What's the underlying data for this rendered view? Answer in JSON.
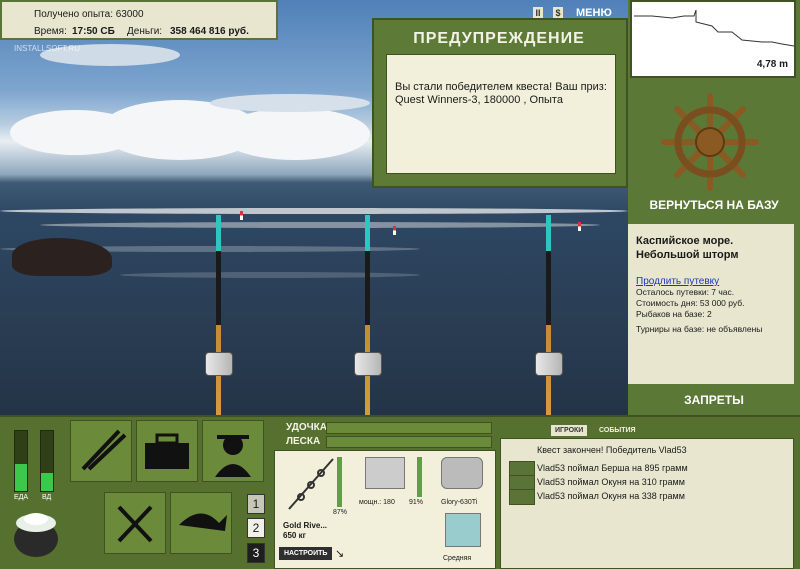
{
  "hud": {
    "exp_label": "Получено опыта: 63000",
    "time_label": "Время:",
    "time_value": "17:50 СБ",
    "money_label": "Деньги:",
    "money_value": "358 464 816 руб.",
    "watermark": "INSTALLSOFT.RU"
  },
  "window_controls": {
    "pause": "II",
    "dollar": "$",
    "menu": "МЕНЮ"
  },
  "warning": {
    "title": "ПРЕДУПРЕЖДЕНИЕ",
    "text": "Вы стали победителем квеста! Ваш приз: Quest Winners-3, 180000 , Опыта"
  },
  "minimap": {
    "depth": "4,78 m"
  },
  "base": {
    "back_label": "ВЕРНУТЬСЯ НА БАЗУ",
    "location": "Каспийское море.",
    "weather": "Небольшой шторм",
    "extend_link": "Продлить путевку",
    "stats": [
      "Осталось путевки: 7 час.",
      "Стоимость дня: 53 000 руб.",
      "Рыбаков на базе: 2"
    ],
    "tournaments": "Турниры на базе: не объявлены",
    "bans_label": "ЗАПРЕТЫ"
  },
  "meters": {
    "food_label": "ЕДА",
    "vd_label": "ВД",
    "food_level": 0.45,
    "vd_level": 0.3
  },
  "slots": [
    "1",
    "2",
    "3"
  ],
  "gear": {
    "rod_label": "УДОЧКА",
    "line_label": "ЛЕСКА",
    "rod_name": "Gold Rive...",
    "rod_capacity": "650 кг",
    "rod_percent": "87%",
    "reel_power": "мощн.: 180",
    "reel_percent": "91%",
    "line_name": "Glory-630Ti",
    "lure_label": "Средняя",
    "setup_button": "НАСТРОИТЬ"
  },
  "events": {
    "tab_players": "ИГРОКИ",
    "tab_events": "СОБЫТИЯ",
    "rows": [
      "Квест закончен! Победитель Vlad53",
      "Vlad53 поймал Берша на 895 грамм",
      "Vlad53 поймал Окуня на 310 грамм",
      "Vlad53 поймал Окуня на 338 грамм"
    ]
  }
}
